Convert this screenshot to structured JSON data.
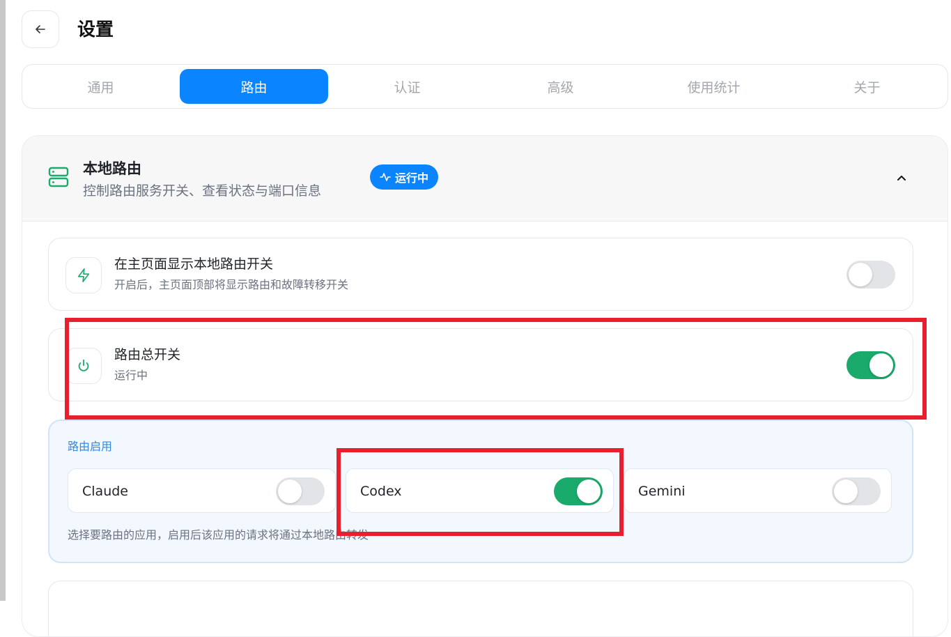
{
  "header": {
    "back_icon": "arrow-left-icon",
    "title": "设置"
  },
  "tabs": [
    {
      "label": "通用",
      "active": false
    },
    {
      "label": "路由",
      "active": true
    },
    {
      "label": "认证",
      "active": false
    },
    {
      "label": "高级",
      "active": false
    },
    {
      "label": "使用统计",
      "active": false
    },
    {
      "label": "关于",
      "active": false
    }
  ],
  "section": {
    "icon": "server-icon",
    "title": "本地路由",
    "subtitle": "控制路由服务开关、查看状态与端口信息",
    "status_badge": {
      "icon": "activity-icon",
      "label": "运行中"
    },
    "collapse_icon": "chevron-up-icon"
  },
  "show_switch_row": {
    "icon": "zap-icon",
    "title": "在主页面显示本地路由开关",
    "description": "开启后，主页面顶部将显示路由和故障转移开关",
    "enabled": false
  },
  "master_switch_row": {
    "icon": "power-icon",
    "title": "路由总开关",
    "description": "运行中",
    "enabled": true
  },
  "route_enable": {
    "label": "路由启用",
    "apps": [
      {
        "name": "Claude",
        "enabled": false
      },
      {
        "name": "Codex",
        "enabled": true
      },
      {
        "name": "Gemini",
        "enabled": false
      }
    ],
    "hint": "选择要路由的应用，启用后该应用的请求将通过本地路由转发"
  },
  "colors": {
    "accent": "#0a84ff",
    "toggle_on": "#1aaa6b",
    "icon_green": "#1aaa6b",
    "highlight": "#e8202e"
  }
}
